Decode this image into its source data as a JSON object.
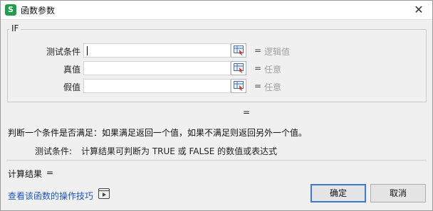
{
  "window": {
    "title": "函数参数",
    "app_icon_letter": "S",
    "close_symbol": "✕"
  },
  "group": {
    "legend": "IF",
    "args": [
      {
        "label": "测试条件",
        "value": "",
        "equals": "=",
        "hint": "逻辑值"
      },
      {
        "label": "真值",
        "value": "",
        "equals": "=",
        "hint": "任意"
      },
      {
        "label": "假值",
        "value": "",
        "equals": "=",
        "hint": "任意"
      }
    ]
  },
  "result_equals": "=",
  "description": "判断一个条件是否满足：如果满足返回一个值，如果不满足则返回另外一个值。",
  "param_help": {
    "name": "测试条件:",
    "text": "计算结果可判断为 TRUE 或 FALSE 的数值或表达式"
  },
  "calc_result": {
    "label": "计算结果",
    "equals": "="
  },
  "help_link": "查看该函数的操作技巧",
  "buttons": {
    "ok": "确定",
    "cancel": "取消"
  },
  "colors": {
    "link": "#1a56c4",
    "hint": "#a0a0a0",
    "app_icon": "#1f9e4a",
    "ok_border": "#3a7bd5"
  }
}
